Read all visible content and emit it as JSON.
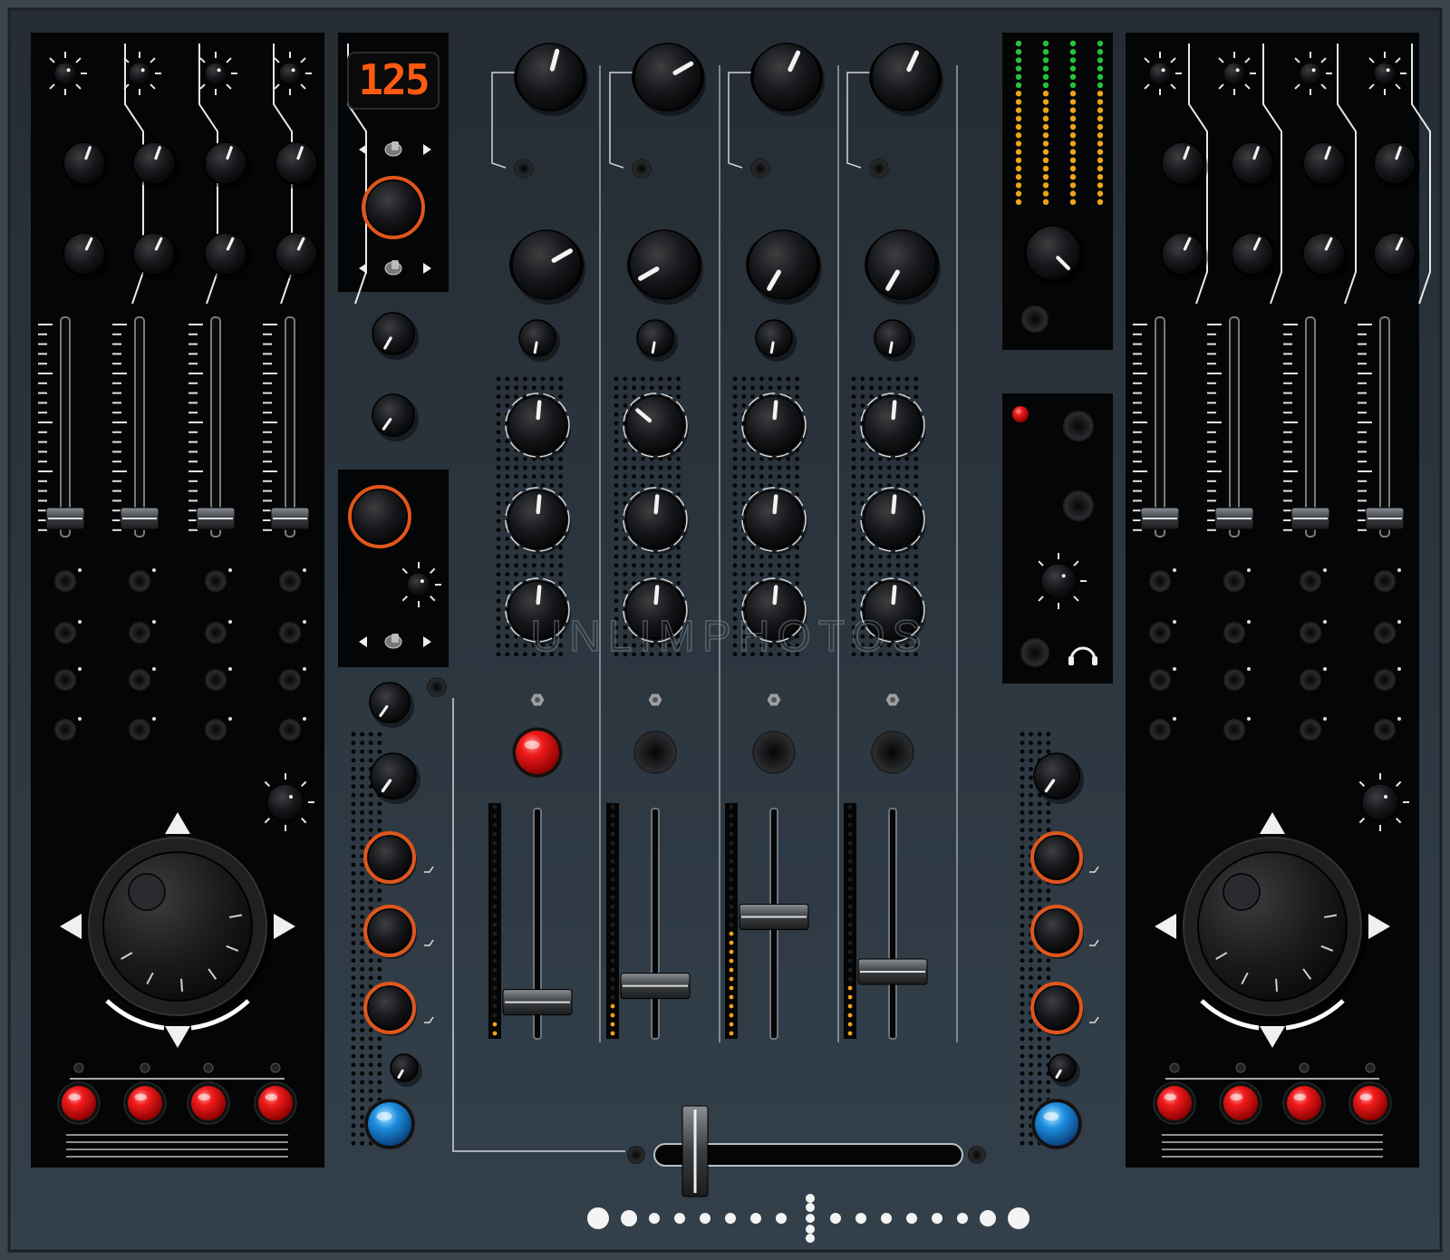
{
  "display": {
    "bpm": "125"
  },
  "watermark": "UNLIMPHOTOS",
  "colors": {
    "body": "#2e3842",
    "panel": "#050607",
    "knob": "#151617",
    "ring_orange": "#e0561c",
    "button_red": "#e01515",
    "button_blue": "#1d8fe0",
    "led_green": "#27c23b",
    "led_orange": "#f0a21c",
    "segment": "#ff5a10"
  },
  "decks": [
    {
      "side": "left",
      "loop_buttons": 4,
      "pads": 4
    },
    {
      "side": "right",
      "loop_buttons": 4,
      "pads": 4
    }
  ],
  "mixer": {
    "channels": [
      {
        "channel": 1,
        "fader": 0.1,
        "level": 0.04,
        "cue_lit": true
      },
      {
        "channel": 2,
        "fader": 0.18,
        "level": 0.14,
        "cue_lit": false
      },
      {
        "channel": 3,
        "fader": 0.52,
        "level": 0.47,
        "cue_lit": false
      },
      {
        "channel": 4,
        "fader": 0.25,
        "level": 0.2,
        "cue_lit": false
      }
    ],
    "crossfader": 0.1
  },
  "master_meter": {
    "columns": 4,
    "segments": 20
  }
}
